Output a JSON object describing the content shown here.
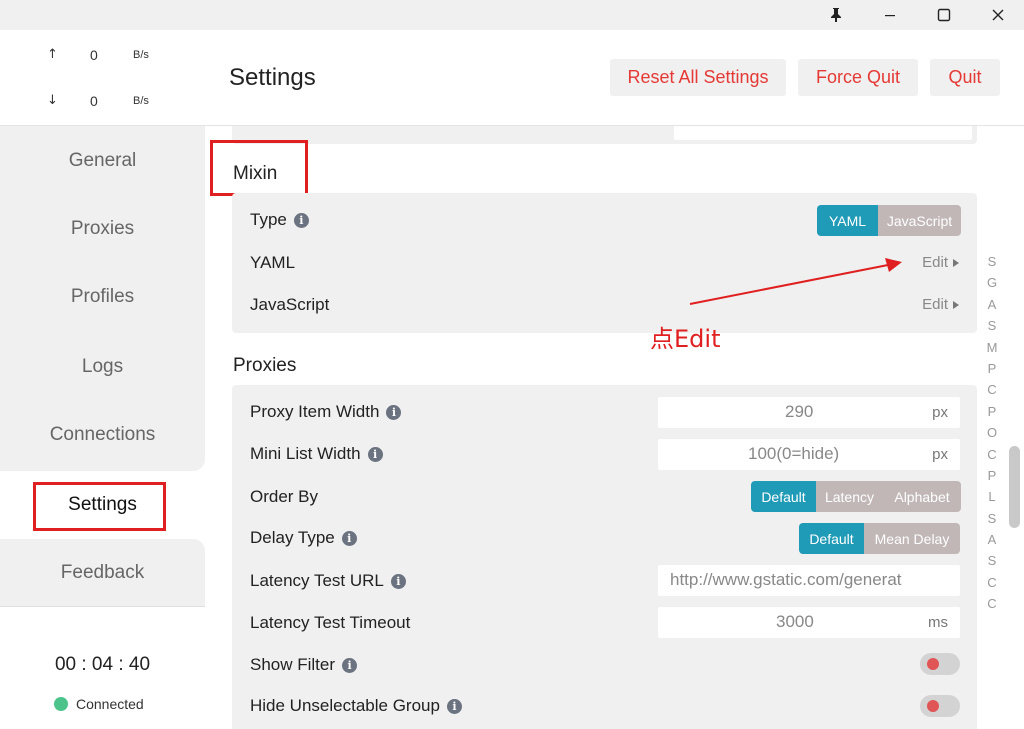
{
  "titlebar": {
    "pin_icon": "pin-icon",
    "minimize_icon": "minimize-icon",
    "maximize_icon": "maximize-icon",
    "close_icon": "close-icon"
  },
  "traffic": {
    "up": {
      "arrow": "↑",
      "value": "0",
      "unit": "B/s"
    },
    "down": {
      "arrow": "↓",
      "value": "0",
      "unit": "B/s"
    }
  },
  "nav": {
    "items": [
      "General",
      "Proxies",
      "Profiles",
      "Logs",
      "Connections",
      "Settings",
      "Feedback"
    ],
    "active": "Settings"
  },
  "status": {
    "timer": "00 : 04 : 40",
    "connection": "Connected",
    "connection_color": "#4cc38a"
  },
  "header": {
    "title": "Settings",
    "buttons": [
      "Reset All Settings",
      "Force Quit",
      "Quit"
    ]
  },
  "mixin": {
    "title": "Mixin",
    "type_label": "Type",
    "type_options": [
      "YAML",
      "JavaScript"
    ],
    "type_selected": "YAML",
    "yaml_label": "YAML",
    "yaml_action": "Edit",
    "js_label": "JavaScript",
    "js_action": "Edit"
  },
  "proxies": {
    "title": "Proxies",
    "proxy_item_width": {
      "label": "Proxy Item Width",
      "value": "290",
      "unit": "px"
    },
    "mini_list_width": {
      "label": "Mini List Width",
      "value": "100(0=hide)",
      "unit": "px"
    },
    "order_by": {
      "label": "Order By",
      "options": [
        "Default",
        "Latency",
        "Alphabet"
      ],
      "selected": "Default"
    },
    "delay_type": {
      "label": "Delay Type",
      "options": [
        "Default",
        "Mean Delay"
      ],
      "selected": "Default"
    },
    "latency_test_url": {
      "label": "Latency Test URL",
      "value": "http://www.gstatic.com/generat"
    },
    "latency_test_timeout": {
      "label": "Latency Test Timeout",
      "value": "3000",
      "unit": "ms"
    },
    "show_filter": {
      "label": "Show Filter"
    },
    "hide_unselectable_group": {
      "label": "Hide Unselectable Group"
    }
  },
  "alphabet_index": [
    "S",
    "G",
    "A",
    "S",
    "M",
    "P",
    "C",
    "P",
    "O",
    "C",
    "P",
    "L",
    "S",
    "A",
    "S",
    "C",
    "C"
  ],
  "annotation": {
    "text": "点Edit",
    "color": "#e02020"
  },
  "accent_color": "#1f9ab7",
  "danger_color": "#e53935"
}
